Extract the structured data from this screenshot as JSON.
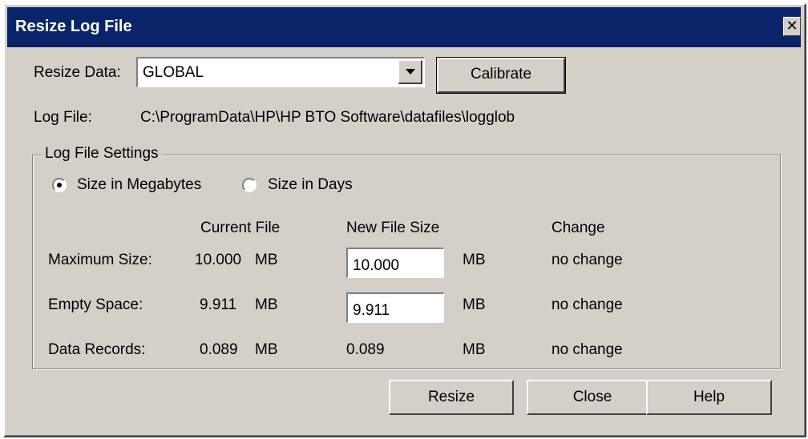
{
  "window": {
    "title": "Resize Log File",
    "close_glyph": "✕",
    "close_icon": "close-icon"
  },
  "resize_data": {
    "label": "Resize Data:",
    "selected": "GLOBAL"
  },
  "buttons": {
    "calibrate": "Calibrate",
    "resize": "Resize",
    "close": "Close",
    "help": "Help"
  },
  "log_file": {
    "label": "Log File:",
    "path": "C:\\ProgramData\\HP\\HP BTO Software\\datafiles\\logglob"
  },
  "settings": {
    "group_title": "Log File Settings",
    "radio_megabytes": "Size in Megabytes",
    "radio_days": "Size in Days",
    "selected_mode": "megabytes"
  },
  "table": {
    "headers": {
      "current": "Current File",
      "new": "New File Size",
      "change": "Change"
    },
    "rows": [
      {
        "label": "Maximum Size:",
        "current_value": "10.000",
        "current_unit": "MB",
        "new_value": "10.000",
        "new_unit": "MB",
        "change": "no change"
      },
      {
        "label": "Empty Space:",
        "current_value": "9.911",
        "current_unit": "MB",
        "new_value": "9.911",
        "new_unit": "MB",
        "change": "no change"
      },
      {
        "label": "Data Records:",
        "current_value": "0.089",
        "current_unit": "MB",
        "new_value": "0.089",
        "new_unit": "MB",
        "change": "no change"
      }
    ]
  }
}
